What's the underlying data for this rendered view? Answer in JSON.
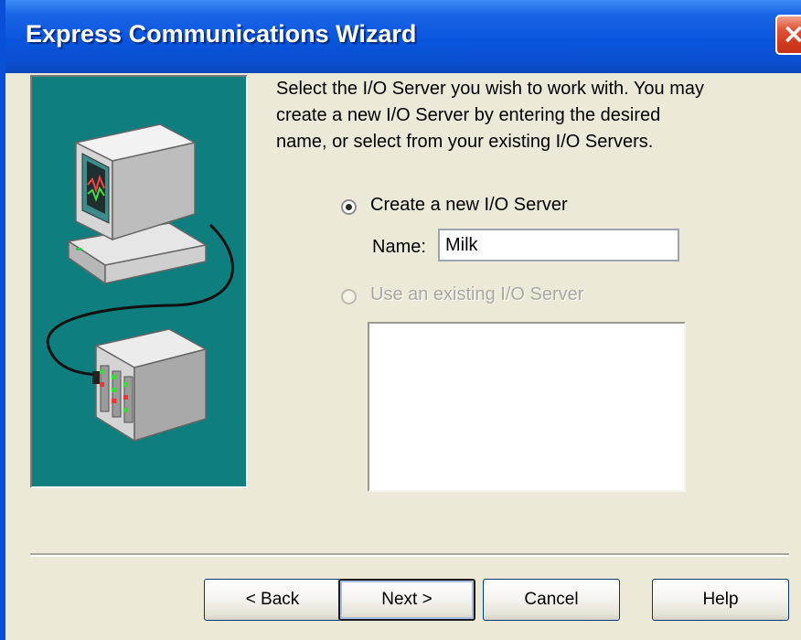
{
  "window": {
    "title": "Express Communications Wizard",
    "close_symbol": "×"
  },
  "instructions": "Select the I/O Server you wish to work with. You may\ncreate a new I/O Server by entering the desired\nname, or select from your existing I/O Servers.",
  "options": {
    "create_new": {
      "label": "Create a new I/O Server",
      "selected": true
    },
    "name_label": "Name:",
    "name_value": "Milk",
    "use_existing": {
      "label": "Use an existing I/O Server",
      "selected": false,
      "enabled": false
    },
    "existing_servers": []
  },
  "buttons": {
    "back": "< Back",
    "next": "Next >",
    "cancel": "Cancel",
    "help": "Help"
  },
  "colors": {
    "titlebar": "#0a4fd8",
    "illustration_bg": "#0e7e7e",
    "dialog_bg": "#ece9d8"
  },
  "icons": [
    "close-icon",
    "computer-icon",
    "plc-rack-icon"
  ]
}
